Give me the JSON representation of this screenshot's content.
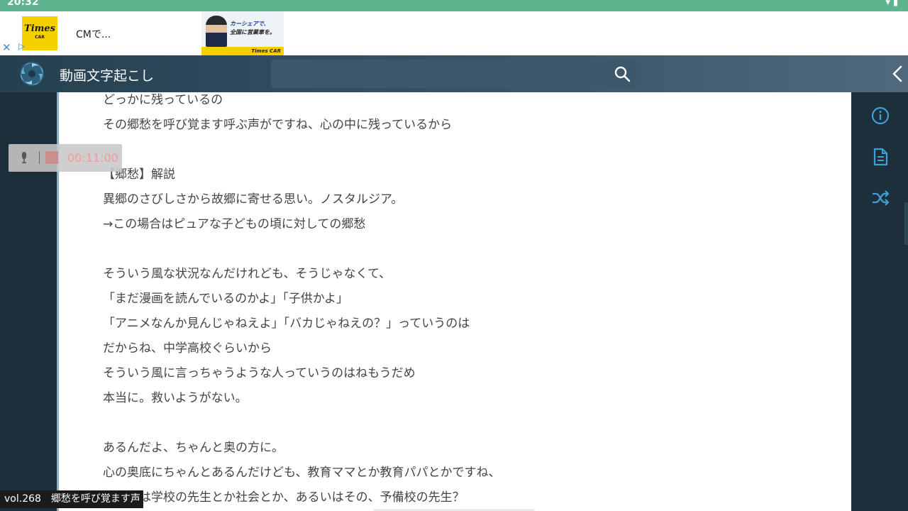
{
  "status_bar": {
    "time": "20:32",
    "icons": [
      "wifi-icon",
      "battery-icon"
    ]
  },
  "ad": {
    "logo_text": "Times",
    "logo_sub": "CAR",
    "text": "CMで...",
    "image_text1": "カーシェアで、",
    "image_text2": "全国に営業車を。",
    "image_strip": "Times CAR"
  },
  "header": {
    "title": "動画文字起こし",
    "search_value": "",
    "search_placeholder": ""
  },
  "transcript": {
    "lines": [
      "どっかに残っているの",
      "その郷愁を呼び覚ます呼ぶ声がですね、心の中に残っているから",
      "",
      "【郷愁】解説",
      "異郷のさびしさから故郷に寄せる思い。ノスタルジア。",
      "→この場合はピュアな子どもの頃に対しての郷愁",
      "",
      "そういう風な状況なんだけれども、そうじゃなくて、",
      "「まだ漫画を読んでいるのかよ」「子供かよ」",
      "「アニメなんか見んじゃねえよ」「バカじゃねえの？」っていうのは",
      "だからね、中学高校ぐらいから",
      "そういう風に言っちゃうような人っていうのはねもうだめ",
      "本当に。救いようがない。",
      "",
      "あるんだよ、ちゃんと奥の方に。",
      "心の奥底にちゃんとあるんだけども、教育ママとか教育パパとかですね、",
      "あるいは学校の先生とか社会とか、あるいはその、予備校の先生？"
    ]
  },
  "recorder": {
    "elapsed": "00:11:00"
  },
  "episode": {
    "vol": "vol.268",
    "title": "郷愁を呼び覚ます声"
  },
  "colors": {
    "status_bar": "#5fb38f",
    "background": "#1d2f3b",
    "header": "#3a5668",
    "accent_icon": "#3fa0d8",
    "recorder_time": "#ee9a9a"
  }
}
